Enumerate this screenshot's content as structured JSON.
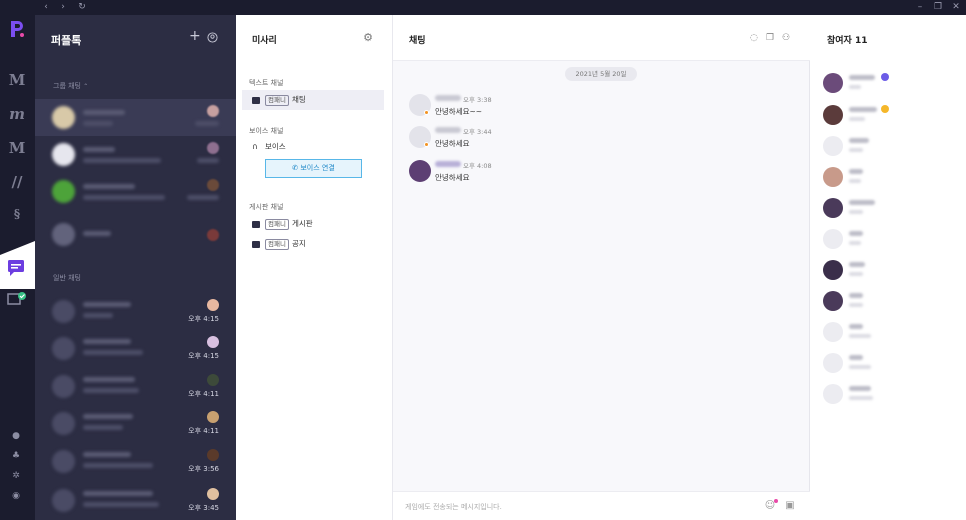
{
  "colors": {
    "rail": "#1b1c2e",
    "list_bg": "#2c2d43",
    "accent": "#6c3de0",
    "online": "#36c185",
    "voice_blue": "#1f88c8",
    "away": "#f39321"
  },
  "window": {
    "nav_icons": [
      "chevron-left-icon",
      "chevron-right-icon",
      "refresh-icon"
    ],
    "controls": [
      "minimize-icon",
      "restore-icon",
      "close-icon"
    ]
  },
  "rail": {
    "games": [
      "M",
      "𝓜",
      "M",
      "//",
      "§"
    ],
    "bottom_icons": [
      "person-icon",
      "bell-icon",
      "gear-icon",
      "help-icon"
    ]
  },
  "list": {
    "title": "퍼플톡",
    "add_icon": "plus-icon",
    "profile_icon": "user-circle-icon",
    "group_section": "그룹 채팅",
    "normal_section": "일반 채팅",
    "group_rows": [
      {
        "time": ""
      },
      {
        "time": ""
      },
      {
        "time": ""
      },
      {
        "time": ""
      }
    ],
    "normal_rows": [
      {
        "time": "오후 4:15"
      },
      {
        "time": "오후 4:15"
      },
      {
        "time": "오후 4:11"
      },
      {
        "time": "오후 4:11"
      },
      {
        "time": "오후 3:56"
      },
      {
        "time": "오후 3:45"
      }
    ]
  },
  "channels": {
    "title": "미사리",
    "text_section": "텍스트 채널",
    "voice_section": "보이스 채널",
    "board_section": "게시판 채널",
    "text_items": [
      {
        "tag": "컴패니",
        "name": "채팅"
      }
    ],
    "voice_items": [
      {
        "name": "보이스"
      }
    ],
    "voice_connect": "보이스 연결",
    "board_items": [
      {
        "tag": "컴패니",
        "name": "게시판"
      },
      {
        "tag": "컴패니",
        "name": "공지"
      }
    ]
  },
  "chat": {
    "title": "채팅",
    "date": "2021년 5월 20일",
    "messages": [
      {
        "time": "오후 3:38",
        "text": "안녕하세요~~"
      },
      {
        "time": "오후 3:44",
        "text": "안녕하세요"
      },
      {
        "time": "오후 4:08",
        "text": "안녕하세요"
      }
    ],
    "placeholder": "게임에도 전송되는 메시지입니다."
  },
  "members": {
    "title": "참여자 11",
    "count": 11
  }
}
